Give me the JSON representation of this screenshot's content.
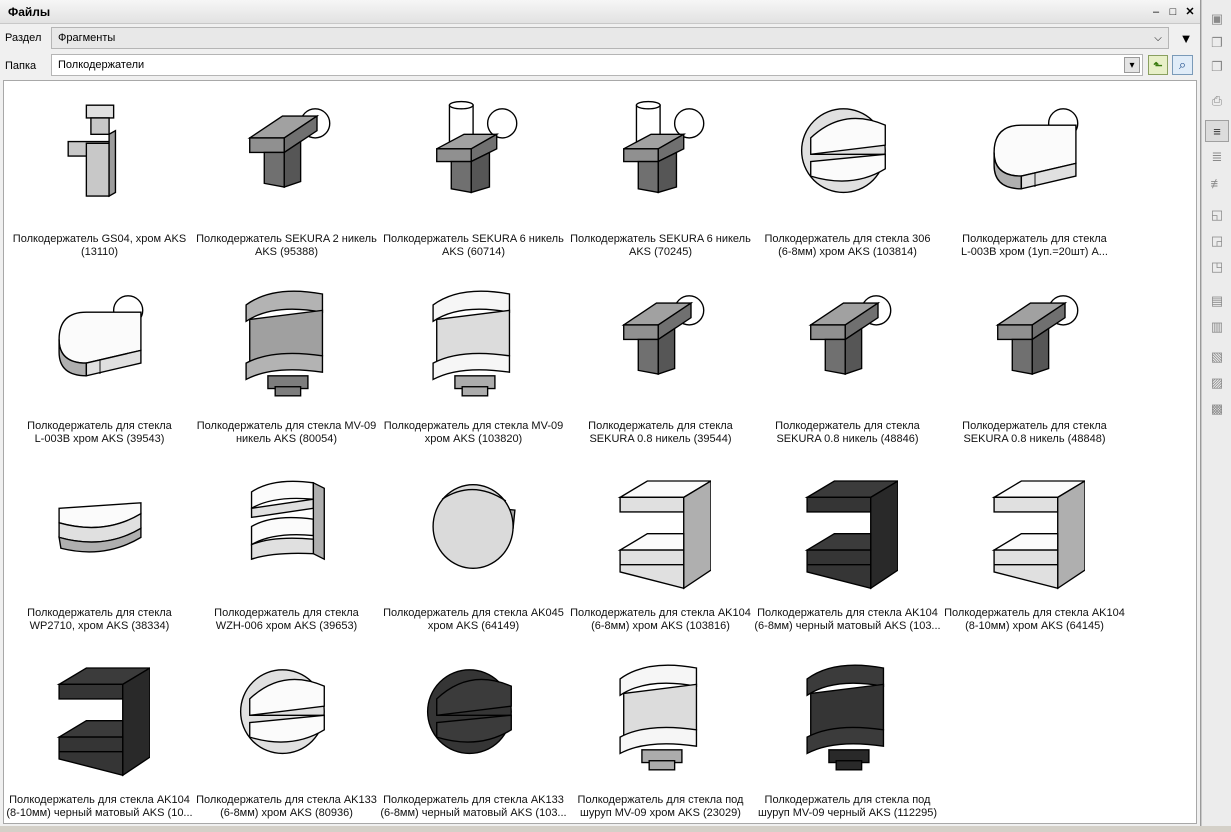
{
  "window": {
    "title": "Файлы"
  },
  "section": {
    "label": "Раздел",
    "value": "Фрагменты"
  },
  "folder": {
    "label": "Папка",
    "value": "Полкодержатели"
  },
  "items": [
    {
      "line1": "Полкодержатель GS04, хром AKS",
      "line2": "(13110)",
      "shape": "gs04",
      "color": "#c8c8c8"
    },
    {
      "line1": "Полкодержатель SEKURA 2 никель",
      "line2": "AKS (95388)",
      "shape": "sekura",
      "color": "#909090"
    },
    {
      "line1": "Полкодержатель SEKURA 6 никель",
      "line2": "AKS  (60714)",
      "shape": "sekura6",
      "color": "#909090"
    },
    {
      "line1": "Полкодержатель SEKURA 6 никель",
      "line2": "AKS  (70245)",
      "shape": "sekura6",
      "color": "#909090"
    },
    {
      "line1": "Полкодержатель для стекла 306",
      "line2": "(6-8мм) хром AKS (103814)",
      "shape": "round",
      "color": "#e0e0e0"
    },
    {
      "line1": "Полкодержатель для стекла",
      "line2": "L-003B хром (1уп.=20шт) A...",
      "shape": "l003",
      "color": "#e0e0e0"
    },
    {
      "line1": "Полкодержатель для стекла",
      "line2": "L-003B хром AKS (39543)",
      "shape": "l003",
      "color": "#e0e0e0"
    },
    {
      "line1": "Полкодержатель для стекла MV-09",
      "line2": "никель AKS (80054)",
      "shape": "mv09",
      "color": "#a0a0a0"
    },
    {
      "line1": "Полкодержатель для стекла MV-09",
      "line2": "хром AKS (103820)",
      "shape": "mv09",
      "color": "#dcdcdc"
    },
    {
      "line1": "Полкодержатель для стекла",
      "line2": "SEKURA 0.8 никель  (39544)",
      "shape": "sekura",
      "color": "#909090"
    },
    {
      "line1": "Полкодержатель для стекла",
      "line2": "SEKURA 0.8 никель (48846)",
      "shape": "sekura",
      "color": "#909090"
    },
    {
      "line1": "Полкодержатель для стекла",
      "line2": "SEKURA 0.8 никель (48848)",
      "shape": "sekura",
      "color": "#909090"
    },
    {
      "line1": "Полкодержатель для стекла",
      "line2": "WP2710, хром AKS (38334)",
      "shape": "wp",
      "color": "#e0e0e0"
    },
    {
      "line1": "Полкодержатель для стекла",
      "line2": "WZH-006 хром AKS (39653)",
      "shape": "wzh",
      "color": "#e0e0e0"
    },
    {
      "line1": "Полкодержатель для стекла AK045",
      "line2": "хром AKS (64149)",
      "shape": "disc",
      "color": "#dadada"
    },
    {
      "line1": "Полкодержатель для стекла AK104",
      "line2": "(6-8мм) хром AKS (103816)",
      "shape": "ak104",
      "color": "#e0e0e0"
    },
    {
      "line1": "Полкодержатель для стекла AK104",
      "line2": "(6-8мм) черный матовый AKS (103...",
      "shape": "ak104",
      "color": "#353535"
    },
    {
      "line1": "Полкодержатель для стекла AK104",
      "line2": "(8-10мм) хром AKS (64145)",
      "shape": "ak104",
      "color": "#e0e0e0"
    },
    {
      "line1": "Полкодержатель для стекла AK104",
      "line2": "(8-10мм) черный матовый AKS (10...",
      "shape": "ak104",
      "color": "#353535"
    },
    {
      "line1": "Полкодержатель для стекла AK133",
      "line2": "(6-8мм) хром AKS (80936)",
      "shape": "round",
      "color": "#e0e0e0"
    },
    {
      "line1": "Полкодержатель для стекла AK133",
      "line2": "(6-8мм) черный матовый AKS (103...",
      "shape": "round",
      "color": "#353535"
    },
    {
      "line1": "Полкодержатель для стекла под",
      "line2": "шуруп MV-09 хром AKS (23029)",
      "shape": "mv09",
      "color": "#dcdcdc"
    },
    {
      "line1": "Полкодержатель для стекла под",
      "line2": "шуруп MV-09 черный AKS (112295)",
      "shape": "mv09",
      "color": "#353535"
    }
  ],
  "sidebar_icons": [
    "panel-icon",
    "copy-icon",
    "copy-icon",
    "print-icon",
    "screw-icon",
    "screw-add-icon",
    "screw-remove-icon",
    "layer-icon",
    "layer-add-icon",
    "layer-remove-icon",
    "page-icon",
    "page-add-icon",
    "doc-icon",
    "doc-add-icon",
    "doc-remove-icon"
  ]
}
